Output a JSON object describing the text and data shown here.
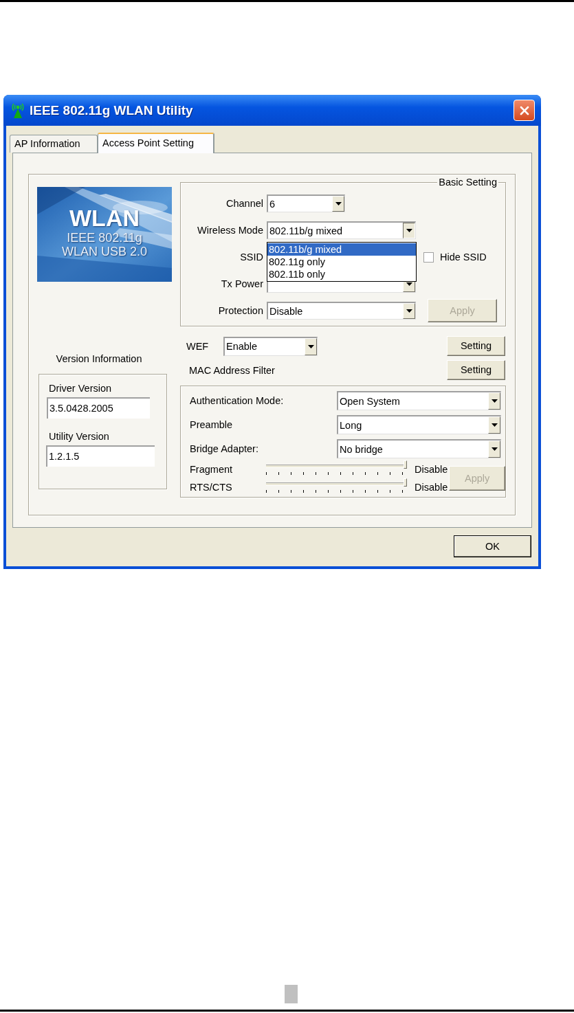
{
  "window": {
    "title": "IEEE 802.11g WLAN Utility"
  },
  "tabs": [
    {
      "label": "AP Information",
      "selected": false
    },
    {
      "label": "Access Point Setting",
      "selected": true
    }
  ],
  "banner": {
    "lines": [
      "WLAN",
      "IEEE 802.11g",
      "WLAN USB 2.0"
    ]
  },
  "version_information": {
    "title": "Version Information",
    "fields": [
      {
        "label": "Driver Version",
        "value": "3.5.0428.2005"
      },
      {
        "label": "Utility Version",
        "value": "1.2.1.5"
      }
    ]
  },
  "basic_setting": {
    "title": "Basic Setting",
    "channel": {
      "label": "Channel",
      "value": "6"
    },
    "wireless_mode": {
      "label": "Wireless Mode",
      "value": "802.11b/g mixed",
      "expanded": true,
      "options": [
        {
          "label": "802.11b/g mixed",
          "selected": true
        },
        {
          "label": "802.11g only",
          "selected": false
        },
        {
          "label": "802.11b only",
          "selected": false
        }
      ]
    },
    "ssid": {
      "label": "SSID"
    },
    "hide_ssid": {
      "label": "Hide SSID",
      "checked": false
    },
    "tx_power": {
      "label": "Tx Power"
    },
    "protection": {
      "label": "Protection",
      "value": "Disable"
    },
    "apply": {
      "label": "Apply",
      "disabled": true
    }
  },
  "wep": {
    "label": "WEF",
    "value": "Enable",
    "setting": "Setting"
  },
  "mac_filter": {
    "label": "MAC Address Filter",
    "setting": "Setting"
  },
  "advanced": {
    "selects": [
      {
        "label": "Authentication Mode:",
        "value": "Open System"
      },
      {
        "label": "Preamble",
        "value": "Long"
      },
      {
        "label": "Bridge Adapter:",
        "value": "No bridge"
      }
    ],
    "sliders": [
      {
        "label": "Fragment",
        "level": 1,
        "reading": "Disable"
      },
      {
        "label": "RTS/CTS",
        "level": 1,
        "reading": "Disable"
      }
    ],
    "apply": {
      "label": "Apply",
      "disabled": true
    }
  },
  "buttons": [
    {
      "label": "OK"
    }
  ]
}
